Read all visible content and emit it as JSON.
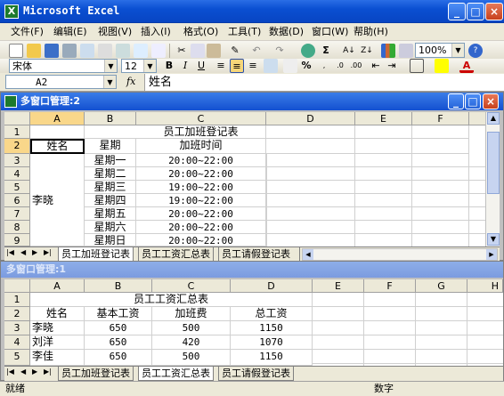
{
  "app": {
    "title": "Microsoft Excel",
    "icon_label": "X"
  },
  "caption_buttons": {
    "minimize": "_",
    "maximize": "□",
    "close": "×"
  },
  "menu": [
    "文件(F)",
    "编辑(E)",
    "视图(V)",
    "插入(I)",
    "格式(O)",
    "工具(T)",
    "数据(D)",
    "窗口(W)",
    "帮助(H)"
  ],
  "toolbar": {
    "zoom": "100%",
    "font_name": "宋体",
    "font_size": "12",
    "bold": "B",
    "italic": "I",
    "underline": "U",
    "sum": "Σ",
    "percent": "%"
  },
  "formula_bar": {
    "name_box": "A2",
    "fx": "fx",
    "content": "姓名"
  },
  "window1": {
    "title": "多窗口管理:2",
    "columns": [
      "A",
      "B",
      "C",
      "D",
      "E",
      "F"
    ],
    "rows": [
      "1",
      "2",
      "3",
      "4",
      "5",
      "6",
      "7",
      "8",
      "9"
    ],
    "title_cell": "员工加班登记表",
    "headers": [
      "姓名",
      "星期",
      "加班时间"
    ],
    "name": "李晓",
    "days": [
      "星期一",
      "星期二",
      "星期三",
      "星期四",
      "星期五",
      "星期六",
      "星期日"
    ],
    "times": [
      "20:00~22:00",
      "20:00~22:00",
      "19:00~22:00",
      "19:00~22:00",
      "20:00~22:00",
      "20:00~22:00",
      "20:00~22:00"
    ],
    "tabs": [
      "员工加班登记表",
      "员工工资汇总表",
      "员工请假登记表"
    ],
    "nav": [
      "|◀",
      "◀",
      "▶",
      "▶|"
    ]
  },
  "window2": {
    "title": "多窗口管理:1",
    "columns": [
      "A",
      "B",
      "C",
      "D",
      "E",
      "F",
      "G",
      "H"
    ],
    "rows": [
      "1",
      "2",
      "3",
      "4",
      "5"
    ],
    "title_cell": "员工工资汇总表",
    "headers": [
      "姓名",
      "基本工资",
      "加班费",
      "总工资"
    ],
    "data": [
      [
        "李晓",
        "650",
        "500",
        "1150"
      ],
      [
        "刘洋",
        "650",
        "420",
        "1070"
      ],
      [
        "李佳",
        "650",
        "500",
        "1150"
      ]
    ],
    "tabs": [
      "员工加班登记表",
      "员工工资汇总表",
      "员工请假登记表"
    ],
    "nav": [
      "|◀",
      "◀",
      "▶",
      "▶|"
    ]
  },
  "status": {
    "left": "就绪",
    "right": "数字"
  },
  "colors": {
    "title_blue": "#0a4fd2",
    "header_gray": "#ece9d8",
    "inactive_title": "#8eaee8"
  }
}
